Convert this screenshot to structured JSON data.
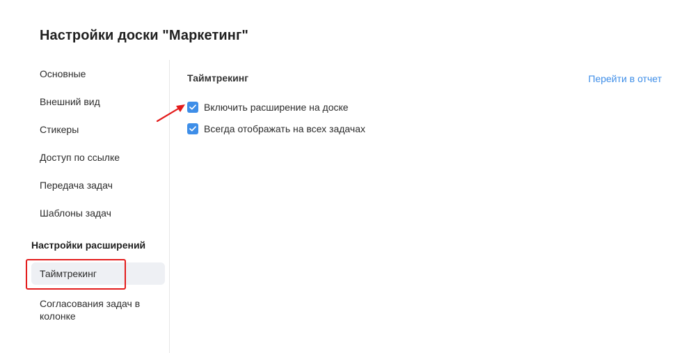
{
  "page": {
    "title": "Настройки доски \"Маркетинг\""
  },
  "sidebar": {
    "items": [
      {
        "label": "Основные"
      },
      {
        "label": "Внешний вид"
      },
      {
        "label": "Стикеры"
      },
      {
        "label": "Доступ по ссылке"
      },
      {
        "label": "Передача задач"
      },
      {
        "label": "Шаблоны задач"
      }
    ],
    "extensions_header": "Настройки расширений",
    "extensions": [
      {
        "label": "Таймтрекинг",
        "active": true
      },
      {
        "label": "Согласования задач в колонке"
      }
    ]
  },
  "main": {
    "section_title": "Таймтрекинг",
    "report_link": "Перейти в отчет",
    "options": [
      {
        "label": "Включить расширение на доске",
        "checked": true
      },
      {
        "label": "Всегда отображать на всех задачах",
        "checked": true
      }
    ]
  },
  "colors": {
    "accent": "#3e8ee8",
    "annotation": "#e31b1b",
    "active_bg": "#eef0f4"
  },
  "icons": {
    "checkbox": "checkmark-icon",
    "annotation": "arrow-icon"
  }
}
